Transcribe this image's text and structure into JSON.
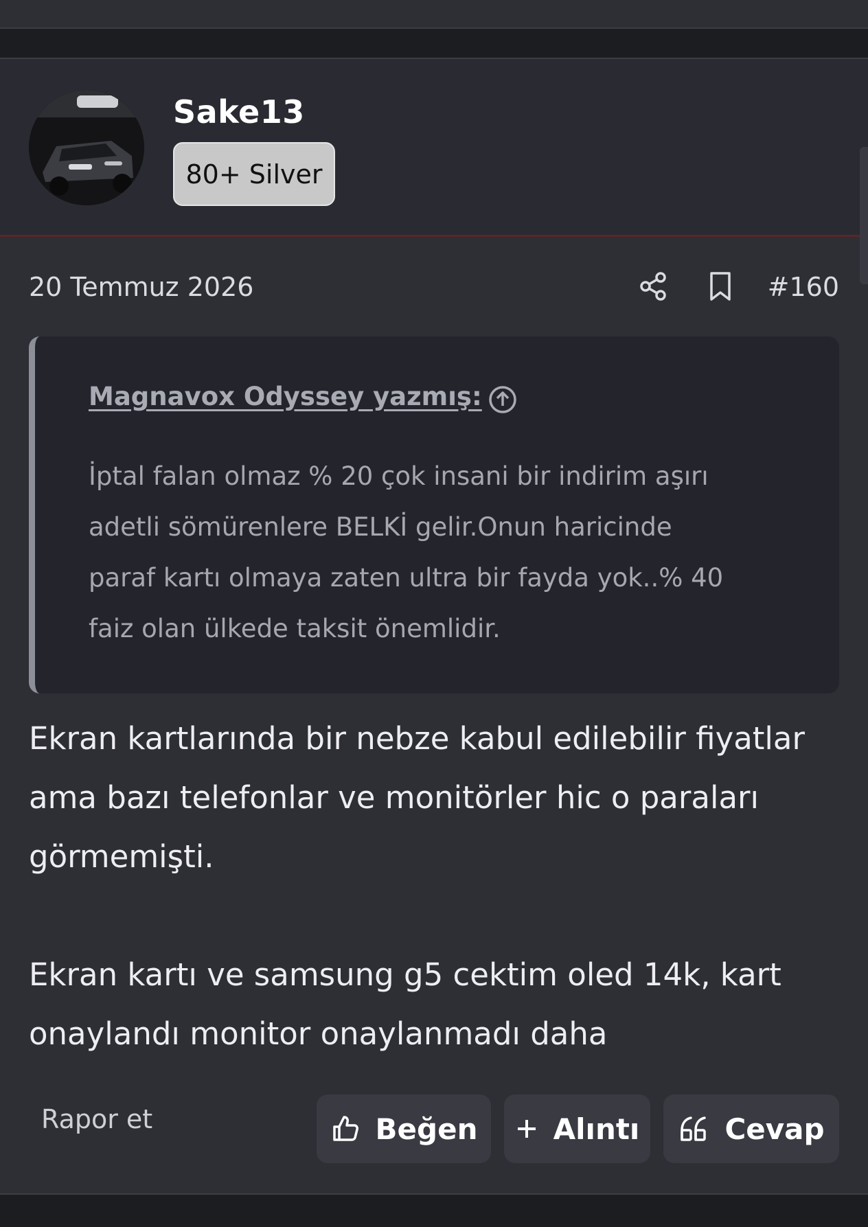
{
  "user": {
    "name": "Sake13",
    "rank": "80+ Silver"
  },
  "post": {
    "date": "20 Temmuz 2026",
    "number": "#160"
  },
  "quote": {
    "author": "Magnavox Odyssey yazmış:",
    "lines": [
      "İptal falan olmaz % 20 çok insani bir indirim aşırı",
      "adetli sömürenlere BELKİ gelir.Onun haricinde",
      "paraf kartı olmaya zaten ultra bir fayda yok..% 40",
      "faiz olan ülkede taksit önemlidir."
    ]
  },
  "body": {
    "paragraph1": [
      "Ekran kartlarında bir nebze kabul edilebilir fiyatlar",
      "ama bazı telefonlar ve monitörler hic o paraları",
      "görmemişti."
    ],
    "paragraph2": [
      "Ekran kartı ve samsung g5 cektim oled 14k, kart",
      "onaylandı monitor onaylanmadı daha"
    ]
  },
  "actions": {
    "report": "Rapor et",
    "like": "Beğen",
    "quote": "Alıntı",
    "reply": "Cevap"
  },
  "icons": {
    "share": "share-icon",
    "bookmark": "bookmark-icon",
    "quote_jump": "arrow-up-circle-icon",
    "like": "thumbs-up-icon",
    "quote": "plus-icon",
    "reply": "quote-marks-icon"
  },
  "colors": {
    "background": "#2e2f35",
    "header": "#2a2b32",
    "header_accent": "#5a2528",
    "quote_background": "#24252c",
    "button": "#393a42",
    "badge": "#c8c8c8"
  }
}
